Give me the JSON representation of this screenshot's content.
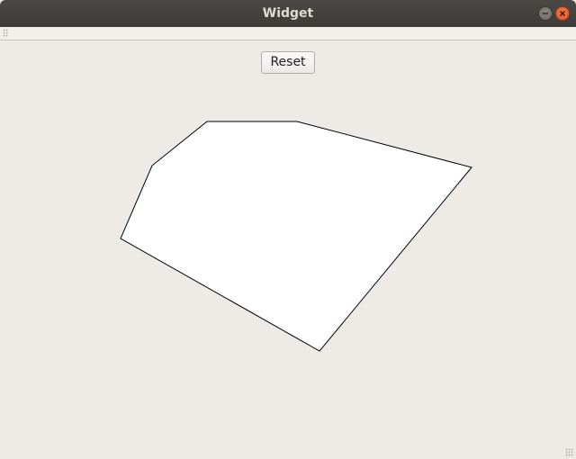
{
  "window": {
    "title": "Widget"
  },
  "controls": {
    "reset_label": "Reset"
  },
  "colors": {
    "titlebar": "#3c3b37",
    "background": "#eeebe7",
    "polygon_fill": "#ffffff",
    "polygon_stroke": "#000000",
    "close_button": "#e0551f"
  },
  "icons": {
    "minimize": "minimize-icon",
    "close": "close-icon"
  }
}
